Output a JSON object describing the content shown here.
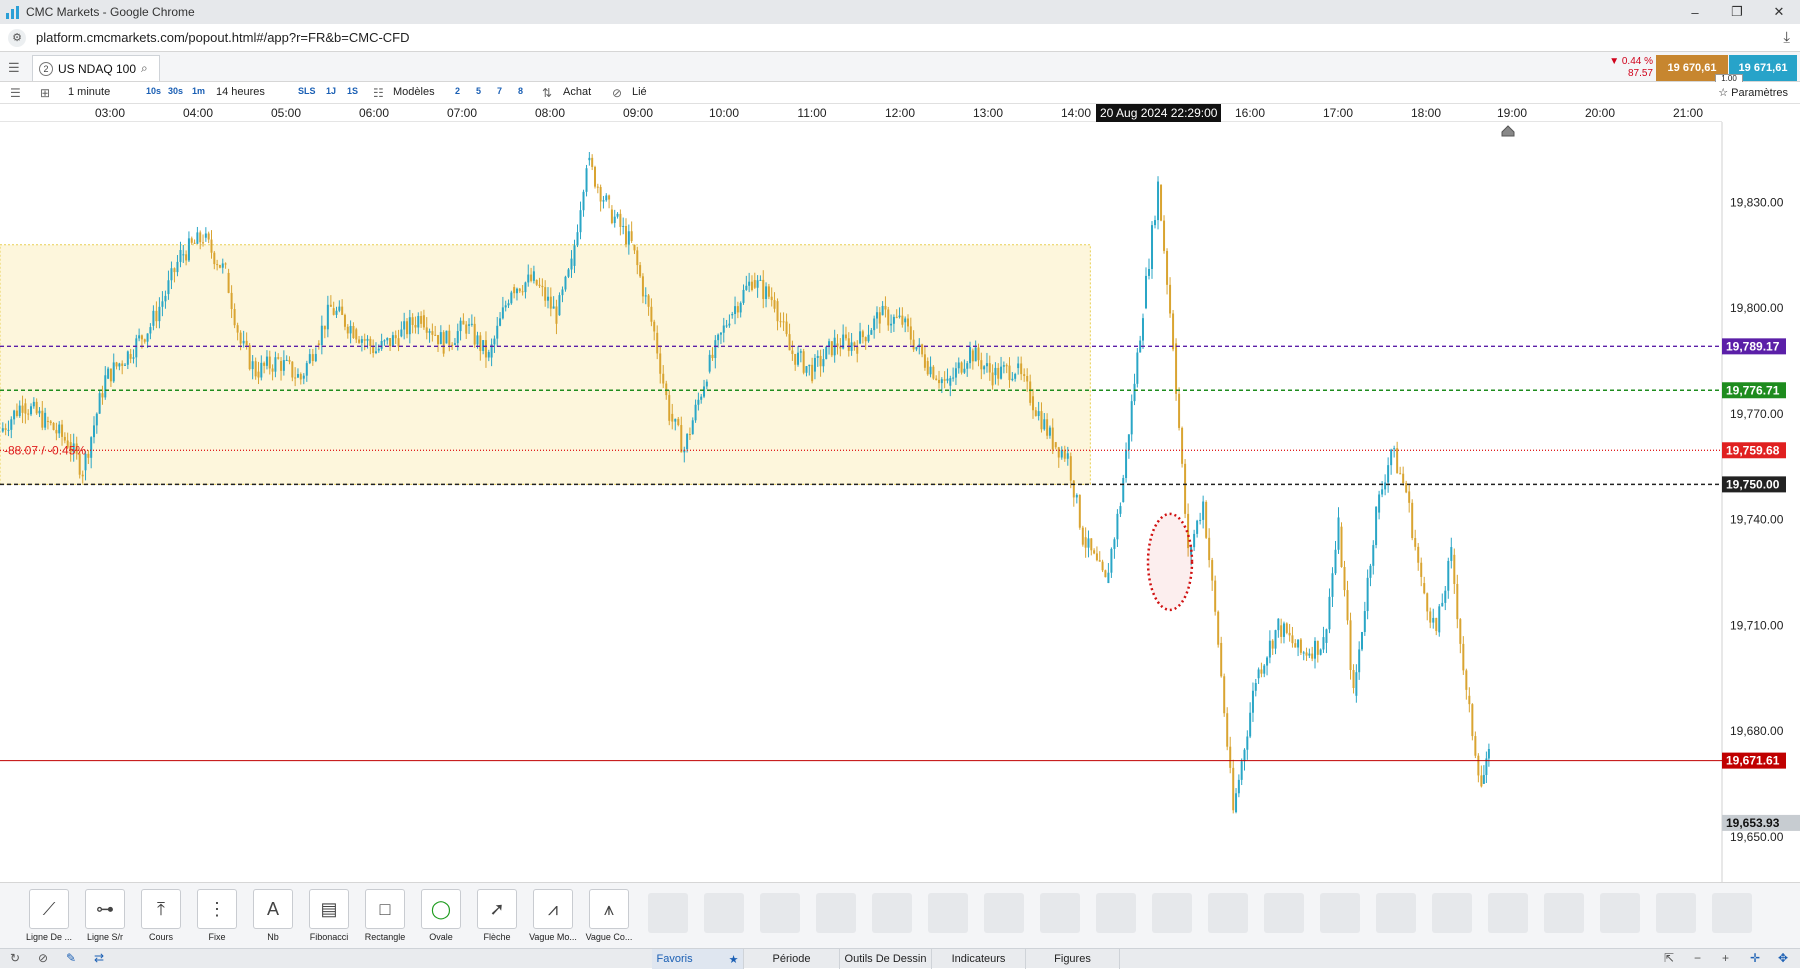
{
  "window": {
    "title": "CMC Markets - Google Chrome",
    "minimize": "–",
    "restore": "❐",
    "close": "✕"
  },
  "address": {
    "url": "platform.cmcmarkets.com/popout.html#/app?r=FR&b=CMC-CFD"
  },
  "instrument": {
    "tab_number": "2",
    "name": "US NDAQ 100",
    "change_pct": "▼ 0.44 %",
    "change_pts": "87.57",
    "sell": "19 670,61",
    "buy": "19 671,61",
    "spread": "1.00"
  },
  "toolbar": {
    "interval": "1 minute",
    "q1": "10s",
    "q2": "30s",
    "q3": "1m",
    "period": "14 heures",
    "sls": "SLS",
    "p1": "1J",
    "p2": "1S",
    "models": "Modèles",
    "n1": "2",
    "n2": "5",
    "n3": "7",
    "n4": "8",
    "buy": "Achat",
    "linked": "Lié",
    "settings": "Paramètres"
  },
  "timeaxis": {
    "labels": [
      "03:00",
      "04:00",
      "05:00",
      "06:00",
      "07:00",
      "08:00",
      "09:00",
      "10:00",
      "11:00",
      "12:00",
      "13:00",
      "14:00",
      "16:00",
      "17:00",
      "18:00",
      "19:00",
      "20:00",
      "21:00"
    ],
    "crosshair": "20 Aug 2024 22:29:00"
  },
  "chart_data": {
    "type": "candlestick",
    "x_range": [
      "02:35",
      "21:40"
    ],
    "ylim": [
      19640,
      19850
    ],
    "y_ticks": [
      19650,
      19680,
      19710,
      19740,
      19770,
      19800,
      19830
    ],
    "y_tick_labels": [
      "19,650.00",
      "19,680.00",
      "19,710.00",
      "19,740.00",
      "19,770.00",
      "19,800.00",
      "19,830.00"
    ],
    "lines": [
      {
        "value": 19789.17,
        "label": "19,789.17",
        "color": "#5b1fa8",
        "style": "dashed"
      },
      {
        "value": 19776.71,
        "label": "19,776.71",
        "color": "#1e8c1e",
        "style": "dashed"
      },
      {
        "value": 19759.68,
        "label": "19,759.68",
        "color": "#e02020",
        "style": "dotted"
      },
      {
        "value": 19750.0,
        "label": "19,750.00",
        "color": "#222222",
        "style": "dashed"
      },
      {
        "value": 19671.61,
        "label": "19,671.61",
        "color": "#c00000",
        "style": "solid"
      }
    ],
    "min_label": "19,653.93",
    "min_value": 19653.93,
    "measure_label": "-88.07 / -0.45%",
    "box": {
      "y_top": 19818,
      "y_bottom": 19750,
      "x_end": "14:40"
    },
    "series": [
      {
        "name": "NDAQ",
        "points": [
          [
            "02:35",
            19765
          ],
          [
            "02:50",
            19773
          ],
          [
            "03:05",
            19768
          ],
          [
            "03:20",
            19762
          ],
          [
            "03:30",
            19754
          ],
          [
            "03:45",
            19780
          ],
          [
            "04:00",
            19787
          ],
          [
            "04:15",
            19795
          ],
          [
            "04:25",
            19804
          ],
          [
            "04:35",
            19815
          ],
          [
            "04:50",
            19820
          ],
          [
            "05:05",
            19810
          ],
          [
            "05:15",
            19790
          ],
          [
            "05:25",
            19782
          ],
          [
            "05:40",
            19785
          ],
          [
            "05:55",
            19780
          ],
          [
            "06:05",
            19790
          ],
          [
            "06:15",
            19800
          ],
          [
            "06:30",
            19794
          ],
          [
            "06:45",
            19788
          ],
          [
            "07:00",
            19792
          ],
          [
            "07:15",
            19798
          ],
          [
            "07:30",
            19790
          ],
          [
            "07:45",
            19795
          ],
          [
            "08:00",
            19786
          ],
          [
            "08:15",
            19806
          ],
          [
            "08:30",
            19808
          ],
          [
            "08:45",
            19798
          ],
          [
            "08:55",
            19812
          ],
          [
            "09:05",
            19842
          ],
          [
            "09:20",
            19828
          ],
          [
            "09:35",
            19818
          ],
          [
            "09:50",
            19793
          ],
          [
            "10:00",
            19770
          ],
          [
            "10:10",
            19760
          ],
          [
            "10:25",
            19782
          ],
          [
            "10:40",
            19798
          ],
          [
            "10:55",
            19808
          ],
          [
            "11:10",
            19802
          ],
          [
            "11:20",
            19788
          ],
          [
            "11:35",
            19782
          ],
          [
            "11:50",
            19790
          ],
          [
            "12:05",
            19790
          ],
          [
            "12:20",
            19798
          ],
          [
            "12:35",
            19796
          ],
          [
            "12:50",
            19785
          ],
          [
            "13:05",
            19778
          ],
          [
            "13:20",
            19788
          ],
          [
            "13:35",
            19781
          ],
          [
            "13:50",
            19783
          ],
          [
            "14:00",
            19775
          ],
          [
            "14:15",
            19762
          ],
          [
            "14:25",
            19758
          ],
          [
            "14:35",
            19735
          ],
          [
            "14:50",
            19722
          ],
          [
            "15:00",
            19745
          ],
          [
            "15:15",
            19800
          ],
          [
            "15:25",
            19835
          ],
          [
            "15:35",
            19790
          ],
          [
            "15:45",
            19730
          ],
          [
            "15:55",
            19745
          ],
          [
            "16:05",
            19705
          ],
          [
            "16:15",
            19657
          ],
          [
            "16:30",
            19695
          ],
          [
            "16:45",
            19710
          ],
          [
            "17:00",
            19702
          ],
          [
            "17:15",
            19705
          ],
          [
            "17:25",
            19738
          ],
          [
            "17:35",
            19690
          ],
          [
            "17:50",
            19742
          ],
          [
            "18:00",
            19760
          ],
          [
            "18:10",
            19748
          ],
          [
            "18:20",
            19722
          ],
          [
            "18:30",
            19708
          ],
          [
            "18:40",
            19730
          ],
          [
            "18:50",
            19690
          ],
          [
            "19:00",
            19665
          ],
          [
            "19:05",
            19672
          ]
        ]
      }
    ]
  },
  "tools": [
    {
      "label": "Ligne De ...",
      "icon": "line-tool-icon"
    },
    {
      "label": "Ligne S/r",
      "icon": "support-line-icon"
    },
    {
      "label": "Cours",
      "icon": "price-tool-icon"
    },
    {
      "label": "Fixe",
      "icon": "fixed-tool-icon"
    },
    {
      "label": "Nb",
      "icon": "text-tool-icon"
    },
    {
      "label": "Fibonacci",
      "icon": "fibonacci-icon"
    },
    {
      "label": "Rectangle",
      "icon": "rectangle-icon"
    },
    {
      "label": "Ovale",
      "icon": "oval-icon"
    },
    {
      "label": "Flèche",
      "icon": "arrow-icon"
    },
    {
      "label": "Vague Mo...",
      "icon": "wave-mo-icon"
    },
    {
      "label": "Vague Co...",
      "icon": "wave-co-icon"
    }
  ],
  "bottom_tabs": {
    "fav": "Favoris",
    "period": "Période",
    "drawing": "Outils De Dessin",
    "indicators": "Indicateurs",
    "figures": "Figures"
  },
  "colors": {
    "bull": "#2aa6c6",
    "bear": "#d9a431",
    "box": "#fdf6dc"
  }
}
